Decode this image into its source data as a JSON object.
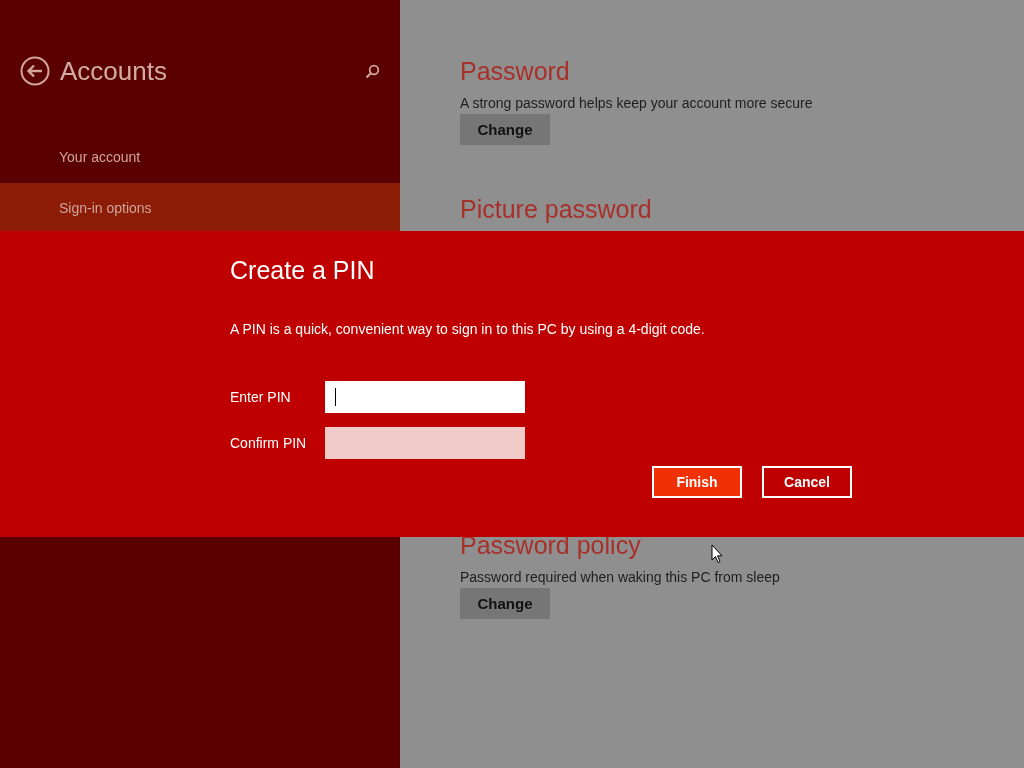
{
  "sidebar": {
    "title": "Accounts",
    "items": [
      {
        "label": "Your account",
        "selected": false
      },
      {
        "label": "Sign-in options",
        "selected": true
      }
    ]
  },
  "content": {
    "sections": [
      {
        "heading": "Password",
        "description": "A strong password helps keep your account more secure",
        "button": "Change"
      },
      {
        "heading": "Picture password"
      },
      {
        "heading": "Password policy",
        "description": "Password required when waking this PC from sleep",
        "button": "Change"
      }
    ]
  },
  "dialog": {
    "title": "Create a PIN",
    "description": "A PIN is a quick, convenient way to sign in to this PC by using a 4-digit code.",
    "fields": [
      {
        "label": "Enter PIN",
        "focused": true,
        "disabled": false
      },
      {
        "label": "Confirm PIN",
        "focused": false,
        "disabled": true
      }
    ],
    "buttons": [
      {
        "label": "Finish",
        "kind": "primary"
      },
      {
        "label": "Cancel",
        "kind": "secondary"
      }
    ]
  }
}
